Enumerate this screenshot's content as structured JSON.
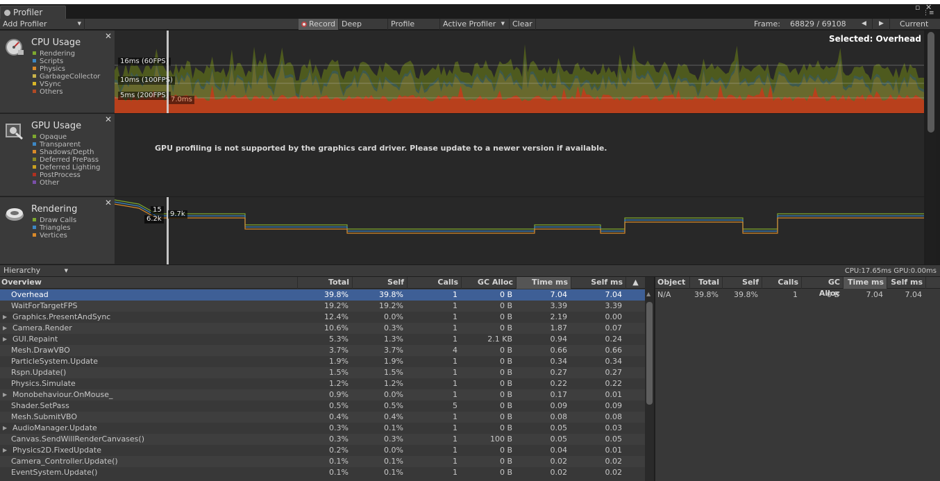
{
  "window": {
    "tab_title": "Profiler",
    "minimize_glyph": "▫",
    "close_glyph": "✕",
    "menu_glyph": "⋮≡"
  },
  "toolbar": {
    "add_profiler": "Add Profiler",
    "record": "Record",
    "deep_profile": "Deep Profile",
    "profile_editor": "Profile Editor",
    "active_profiler": "Active Profiler",
    "clear": "Clear",
    "frame_label": "Frame:",
    "frame_value": "68829 / 69108",
    "prev_glyph": "◀",
    "next_glyph": "▶",
    "current": "Current"
  },
  "cpu_module": {
    "title": "CPU Usage",
    "legend": [
      {
        "label": "Rendering",
        "color": "#7ea82f"
      },
      {
        "label": "Scripts",
        "color": "#3d87c4"
      },
      {
        "label": "Physics",
        "color": "#d98a2a"
      },
      {
        "label": "GarbageCollector",
        "color": "#c9b44a"
      },
      {
        "label": "VSync",
        "color": "#d8b628"
      },
      {
        "label": "Others",
        "color": "#b04a25"
      }
    ],
    "labels": {
      "l60": "16ms (60FPS)",
      "l100": "10ms (100FPS)",
      "l200": "5ms (200FPS)"
    },
    "cursor_value": "7.0ms",
    "selected": "Selected: Overhead"
  },
  "gpu_module": {
    "title": "GPU Usage",
    "legend": [
      {
        "label": "Opaque",
        "color": "#7ea82f"
      },
      {
        "label": "Transparent",
        "color": "#3d87c4"
      },
      {
        "label": "Shadows/Depth",
        "color": "#d98a2a"
      },
      {
        "label": "Deferred PrePass",
        "color": "#8a8a22"
      },
      {
        "label": "Deferred Lighting",
        "color": "#c9a020"
      },
      {
        "label": "PostProcess",
        "color": "#b03020"
      },
      {
        "label": "Other",
        "color": "#7a4fa8"
      }
    ],
    "message": "GPU profiling is not supported by the graphics card driver. Please update to a newer version if available."
  },
  "rendering_module": {
    "title": "Rendering",
    "legend": [
      {
        "label": "Draw Calls",
        "color": "#7ea82f"
      },
      {
        "label": "Triangles",
        "color": "#3d87c4"
      },
      {
        "label": "Vertices",
        "color": "#d98a2a"
      }
    ],
    "tag_drawcalls": "15",
    "tag_vertices": "6.2k",
    "tag_triangles": "9.7k"
  },
  "hierarchy_bar": {
    "view_mode": "Hierarchy",
    "cpu_gpu": "CPU:17.65ms  GPU:0.00ms"
  },
  "table": {
    "headers": [
      "Overview",
      "Total",
      "Self",
      "Calls",
      "GC Alloc",
      "Time ms",
      "Self ms",
      "▲"
    ],
    "rows": [
      {
        "name": "Overhead",
        "expand": false,
        "total": "39.8%",
        "self": "39.8%",
        "calls": "1",
        "gc": "0 B",
        "time": "7.04",
        "selfms": "7.04"
      },
      {
        "name": "WaitForTargetFPS",
        "expand": false,
        "total": "19.2%",
        "self": "19.2%",
        "calls": "1",
        "gc": "0 B",
        "time": "3.39",
        "selfms": "3.39"
      },
      {
        "name": "Graphics.PresentAndSync",
        "expand": true,
        "total": "12.4%",
        "self": "0.0%",
        "calls": "1",
        "gc": "0 B",
        "time": "2.19",
        "selfms": "0.00"
      },
      {
        "name": "Camera.Render",
        "expand": true,
        "total": "10.6%",
        "self": "0.3%",
        "calls": "1",
        "gc": "0 B",
        "time": "1.87",
        "selfms": "0.07"
      },
      {
        "name": "GUI.Repaint",
        "expand": true,
        "total": "5.3%",
        "self": "1.3%",
        "calls": "1",
        "gc": "2.1 KB",
        "time": "0.94",
        "selfms": "0.24"
      },
      {
        "name": "Mesh.DrawVBO",
        "expand": false,
        "total": "3.7%",
        "self": "3.7%",
        "calls": "4",
        "gc": "0 B",
        "time": "0.66",
        "selfms": "0.66"
      },
      {
        "name": "ParticleSystem.Update",
        "expand": false,
        "total": "1.9%",
        "self": "1.9%",
        "calls": "1",
        "gc": "0 B",
        "time": "0.34",
        "selfms": "0.34"
      },
      {
        "name": "Rspn.Update()",
        "expand": false,
        "total": "1.5%",
        "self": "1.5%",
        "calls": "1",
        "gc": "0 B",
        "time": "0.27",
        "selfms": "0.27"
      },
      {
        "name": "Physics.Simulate",
        "expand": false,
        "total": "1.2%",
        "self": "1.2%",
        "calls": "1",
        "gc": "0 B",
        "time": "0.22",
        "selfms": "0.22"
      },
      {
        "name": "Monobehaviour.OnMouse_",
        "expand": true,
        "total": "0.9%",
        "self": "0.0%",
        "calls": "1",
        "gc": "0 B",
        "time": "0.17",
        "selfms": "0.01"
      },
      {
        "name": "Shader.SetPass",
        "expand": false,
        "total": "0.5%",
        "self": "0.5%",
        "calls": "5",
        "gc": "0 B",
        "time": "0.09",
        "selfms": "0.09"
      },
      {
        "name": "Mesh.SubmitVBO",
        "expand": false,
        "total": "0.4%",
        "self": "0.4%",
        "calls": "1",
        "gc": "0 B",
        "time": "0.08",
        "selfms": "0.08"
      },
      {
        "name": "AudioManager.Update",
        "expand": true,
        "total": "0.3%",
        "self": "0.1%",
        "calls": "1",
        "gc": "0 B",
        "time": "0.05",
        "selfms": "0.03"
      },
      {
        "name": "Canvas.SendWillRenderCanvases()",
        "expand": false,
        "total": "0.3%",
        "self": "0.3%",
        "calls": "1",
        "gc": "100 B",
        "time": "0.05",
        "selfms": "0.05"
      },
      {
        "name": "Physics2D.FixedUpdate",
        "expand": true,
        "total": "0.2%",
        "self": "0.0%",
        "calls": "1",
        "gc": "0 B",
        "time": "0.04",
        "selfms": "0.01"
      },
      {
        "name": "Camera_Controller.Update()",
        "expand": false,
        "total": "0.1%",
        "self": "0.1%",
        "calls": "1",
        "gc": "0 B",
        "time": "0.02",
        "selfms": "0.02"
      },
      {
        "name": "EventSystem.Update()",
        "expand": false,
        "total": "0.1%",
        "self": "0.1%",
        "calls": "1",
        "gc": "0 B",
        "time": "0.02",
        "selfms": "0.02"
      }
    ]
  },
  "object_table": {
    "headers": [
      "Object",
      "Total",
      "Self",
      "Calls",
      "GC Alloc",
      "Time ms",
      "Self ms"
    ],
    "rows": [
      {
        "object": "N/A",
        "total": "39.8%",
        "self": "39.8%",
        "calls": "1",
        "gc": "0 B",
        "time": "7.04",
        "selfms": "7.04"
      }
    ]
  }
}
